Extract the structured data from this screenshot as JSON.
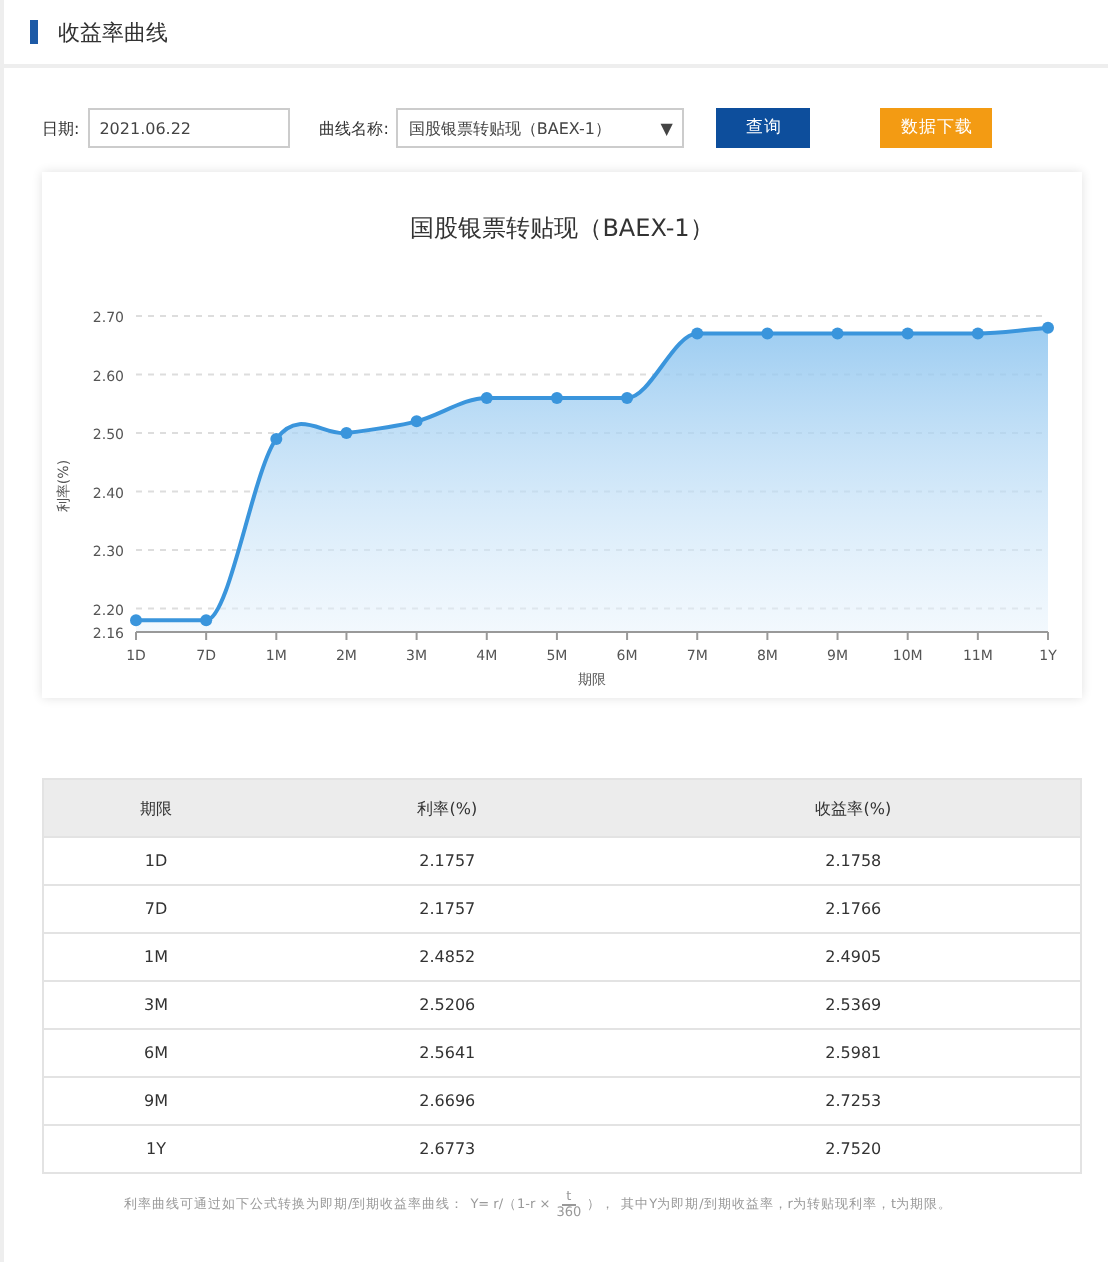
{
  "header": {
    "title": "收益率曲线"
  },
  "filters": {
    "date_label": "日期:",
    "date_value": "2021.06.22",
    "curve_label": "曲线名称:",
    "curve_value": "国股银票转贴现（BAEX-1）",
    "dropdown_glyph": "▼",
    "query_button": "查询",
    "download_button": "数据下载"
  },
  "chart": {
    "chart_data": {
      "type": "area",
      "title": "国股银票转贴现（BAEX-1）",
      "xlabel": "期限",
      "ylabel": "利率(%)",
      "categories": [
        "1D",
        "7D",
        "1M",
        "2M",
        "3M",
        "4M",
        "5M",
        "6M",
        "7M",
        "8M",
        "9M",
        "10M",
        "11M",
        "1Y"
      ],
      "series": [
        {
          "color": "#3a95dc",
          "values": [
            2.18,
            2.18,
            2.49,
            2.5,
            2.52,
            2.56,
            2.56,
            2.56,
            2.67,
            2.67,
            2.67,
            2.67,
            2.67,
            2.68
          ]
        }
      ],
      "grid": true,
      "ylim": [
        2.16,
        2.7
      ],
      "yticks": [
        2.16,
        {
          "value": 2.2,
          "label": "2.20"
        },
        {
          "value": 2.3,
          "label": "2.30"
        },
        {
          "value": 2.4,
          "label": "2.40"
        },
        {
          "value": 2.5,
          "label": "2.50"
        },
        {
          "value": 2.6,
          "label": "2.60"
        },
        {
          "value": 2.7,
          "label": "2.70"
        }
      ]
    }
  },
  "table": {
    "columns": [
      "期限",
      "利率(%)",
      "收益率(%)"
    ],
    "rows": [
      [
        "1D",
        "2.1757",
        "2.1758"
      ],
      [
        "7D",
        "2.1757",
        "2.1766"
      ],
      [
        "1M",
        "2.4852",
        "2.4905"
      ],
      [
        "3M",
        "2.5206",
        "2.5369"
      ],
      [
        "6M",
        "2.5641",
        "2.5981"
      ],
      [
        "9M",
        "2.6696",
        "2.7253"
      ],
      [
        "1Y",
        "2.6773",
        "2.7520"
      ]
    ]
  },
  "note": {
    "before": "利率曲线可通过如下公式转换为即期/到期收益率曲线：",
    "formula_left": "Y= r/（1-r ×",
    "numerator": "t",
    "denominator": "360",
    "formula_right": "），",
    "after": "其中Y为即期/到期收益率，r为转贴现利率，t为期限。"
  }
}
